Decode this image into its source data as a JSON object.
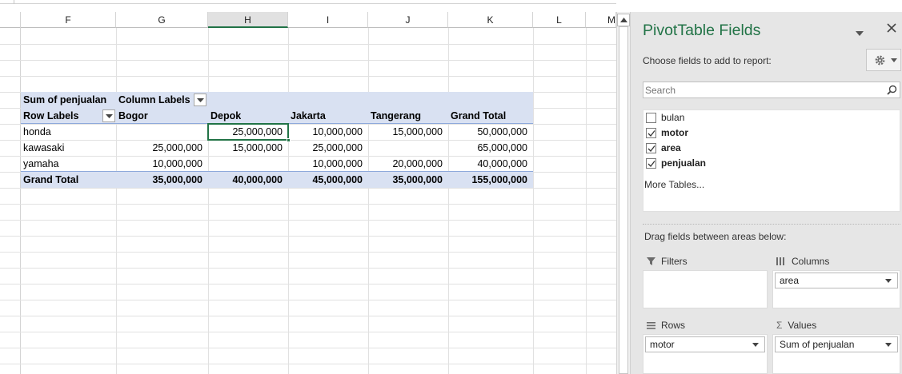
{
  "sheet": {
    "columns": [
      "F",
      "G",
      "H",
      "I",
      "J",
      "K",
      "L",
      "M"
    ],
    "active_column": "H"
  },
  "pivot": {
    "value_field_label": "Sum of penjualan",
    "column_labels": "Column Labels",
    "row_labels": "Row Labels",
    "col_names": [
      "Bogor",
      "Depok",
      "Jakarta",
      "Tangerang",
      "Grand Total"
    ],
    "rows": [
      {
        "label": "honda",
        "values": [
          "",
          "25,000,000",
          "10,000,000",
          "15,000,000",
          "50,000,000"
        ]
      },
      {
        "label": "kawasaki",
        "values": [
          "25,000,000",
          "15,000,000",
          "25,000,000",
          "",
          "65,000,000"
        ]
      },
      {
        "label": "yamaha",
        "values": [
          "10,000,000",
          "",
          "10,000,000",
          "20,000,000",
          "40,000,000"
        ]
      }
    ],
    "grand_total": {
      "label": "Grand Total",
      "values": [
        "35,000,000",
        "40,000,000",
        "45,000,000",
        "35,000,000",
        "155,000,000"
      ]
    },
    "selected_cell": "H"
  },
  "panel": {
    "title": "PivotTable Fields",
    "choose_label": "Choose fields to add to report:",
    "search_placeholder": "Search",
    "fields": [
      {
        "label": "bulan",
        "checked": false
      },
      {
        "label": "motor",
        "checked": true
      },
      {
        "label": "area",
        "checked": true
      },
      {
        "label": "penjualan",
        "checked": true
      }
    ],
    "more_tables": "More Tables...",
    "drag_label": "Drag fields between areas below:",
    "areas": {
      "filters": {
        "label": "Filters",
        "items": []
      },
      "columns": {
        "label": "Columns",
        "items": [
          "area"
        ]
      },
      "rows": {
        "label": "Rows",
        "items": [
          "motor"
        ]
      },
      "values": {
        "label": "Values",
        "items": [
          "Sum of penjualan"
        ]
      }
    },
    "colors": {
      "title": "#217346",
      "pivot_header": "#d9e1f2",
      "selection": "#217346"
    }
  }
}
